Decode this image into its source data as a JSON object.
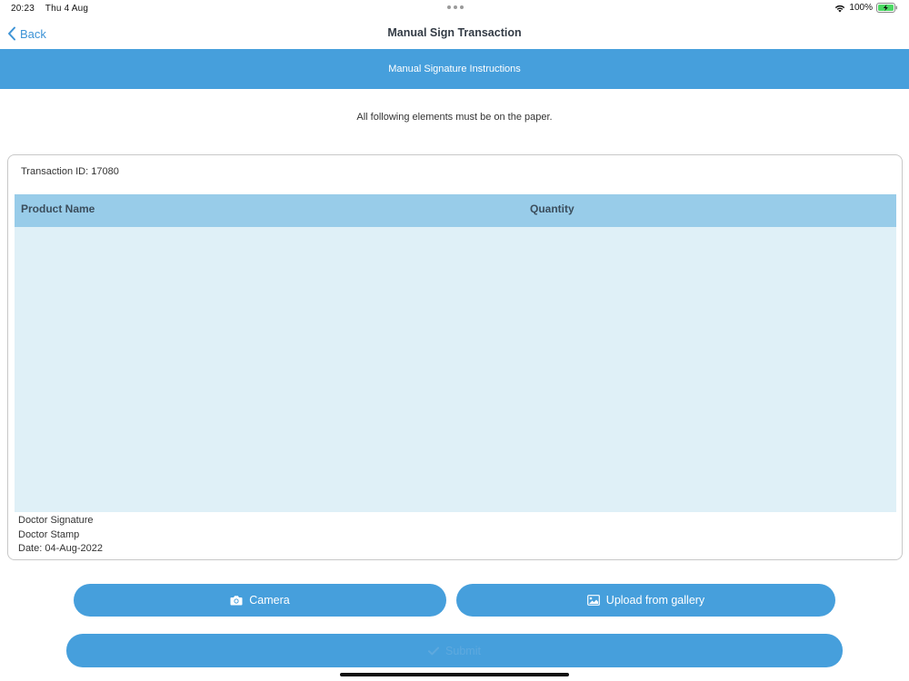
{
  "status_bar": {
    "time": "20:23",
    "date": "Thu 4 Aug",
    "battery": "100%"
  },
  "nav": {
    "back_label": "Back",
    "title": "Manual Sign Transaction"
  },
  "banner": {
    "text": "Manual Signature Instructions"
  },
  "subtitle": "All following elements must be on the paper.",
  "card": {
    "transaction_id": "Transaction ID: 17080",
    "table": {
      "columns": [
        "Product Name",
        "Quantity"
      ],
      "rows": []
    },
    "footer": {
      "doctor_signature": "Doctor Signature",
      "doctor_stamp": "Doctor Stamp",
      "date": "Date: 04-Aug-2022"
    }
  },
  "actions": {
    "camera_label": "Camera",
    "gallery_label": "Upload from gallery",
    "submit_label": "Submit"
  },
  "colors": {
    "accent": "#469fdc",
    "table_header": "#98cce9",
    "table_body": "#dff0f7",
    "battery_green": "#4cd964"
  },
  "icons": {
    "back": "chevron-left-icon",
    "camera": "camera-icon",
    "gallery": "image-icon",
    "submit": "checkmark-icon"
  }
}
